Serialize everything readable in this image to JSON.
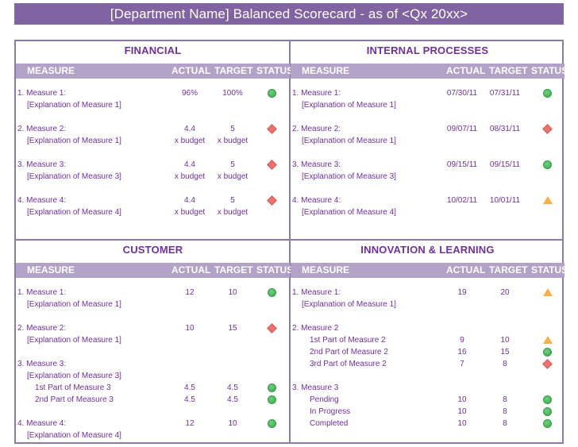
{
  "title": "[Department Name] Balanced Scorecard - as of <Qx 20xx>",
  "colors": {
    "title_bg": "#8064a2",
    "header_bg": "#b3a2c7",
    "text": "#7030a0",
    "border": "#8c7aa8",
    "status_green": "#4caf5a",
    "status_red": "#e8736f",
    "status_yellow": "#f5b04a"
  },
  "columns": {
    "measure": "MEASURE",
    "actual": "ACTUAL",
    "target": "TARGET",
    "status": "STATUS"
  },
  "status_icons": {
    "green": "circle-icon",
    "red": "diamond-icon",
    "yellow": "triangle-icon"
  },
  "financial": {
    "title": "FINANCIAL",
    "rows": [
      {
        "label": "1. Measure 1:",
        "actual": "96%",
        "target": "100%",
        "status": "green"
      },
      {
        "label": "[Explanation of Measure 1]",
        "actual": "",
        "target": ""
      },
      {
        "label": "2. Measure 2:",
        "actual": "4.4",
        "target": "5",
        "status": "red"
      },
      {
        "label": "[Explanation of Measure 1]",
        "actual": "x budget",
        "target": "x budget"
      },
      {
        "label": "3. Measure 3:",
        "actual": "4.4",
        "target": "5",
        "status": "red"
      },
      {
        "label": "[Explanation of Measure 3]",
        "actual": "x budget",
        "target": "x budget"
      },
      {
        "label": "4. Measure 4:",
        "actual": "4.4",
        "target": "5",
        "status": "red"
      },
      {
        "label": "[Explanation of Measure 4]",
        "actual": "x budget",
        "target": "x budget"
      }
    ]
  },
  "internal": {
    "title": "INTERNAL PROCESSES",
    "rows": [
      {
        "label": "1. Measure 1:",
        "actual": "07/30/11",
        "target": "07/31/11",
        "status": "green"
      },
      {
        "label": "[Explanation of Measure 1]"
      },
      {
        "label": "2. Measure 2:",
        "actual": "09/07/11",
        "target": "08/31/11",
        "status": "red"
      },
      {
        "label": "[Explanation of Measure 1]"
      },
      {
        "label": "3. Measure 3:",
        "actual": "09/15/11",
        "target": "09/15/11",
        "status": "green"
      },
      {
        "label": "[Explanation of Measure 3]"
      },
      {
        "label": "4. Measure 4:",
        "actual": "10/02/11",
        "target": "10/01/11",
        "status": "yellow"
      },
      {
        "label": "[Explanation of Measure 4]"
      }
    ]
  },
  "customer": {
    "title": "CUSTOMER",
    "rows": [
      {
        "label": "1. Measure 1:",
        "actual": "12",
        "target": "10",
        "status": "green"
      },
      {
        "label": "[Explanation of Measure 1]"
      },
      {
        "label": "2. Measure 2:",
        "actual": "10",
        "target": "15",
        "status": "red"
      },
      {
        "label": "[Explanation of Measure 1]"
      },
      {
        "label": "3. Measure 3:"
      },
      {
        "label": "[Explanation of Measure 3]"
      },
      {
        "label": "1st Part of Measure 3",
        "actual": "4.5",
        "target": "4.5",
        "status": "green"
      },
      {
        "label": "2nd Part of Measure 3",
        "actual": "4.5",
        "target": "4.5",
        "status": "green"
      },
      {
        "label": "4. Measure 4:",
        "actual": "12",
        "target": "10",
        "status": "green"
      },
      {
        "label": "[Explanation of Measure 4]"
      }
    ]
  },
  "innovation": {
    "title": "INNOVATION & LEARNING",
    "rows": [
      {
        "label": "1. Measure 1:",
        "actual": "19",
        "target": "20",
        "status": "yellow"
      },
      {
        "label": "[Explanation of Measure 1]"
      },
      {
        "label": "2. Measure 2"
      },
      {
        "label": "1st Part of Measure 2",
        "actual": "9",
        "target": "10",
        "status": "yellow"
      },
      {
        "label": "2nd Part of Measure 2",
        "actual": "16",
        "target": "15",
        "status": "green"
      },
      {
        "label": "3rd Part of Measure 2",
        "actual": "7",
        "target": "8",
        "status": "red"
      },
      {
        "label": "3. Measure 3"
      },
      {
        "label": "Pending",
        "actual": "10",
        "target": "8",
        "status": "green"
      },
      {
        "label": "In Progress",
        "actual": "10",
        "target": "8",
        "status": "green"
      },
      {
        "label": "Completed",
        "actual": "10",
        "target": "8",
        "status": "green"
      }
    ]
  }
}
